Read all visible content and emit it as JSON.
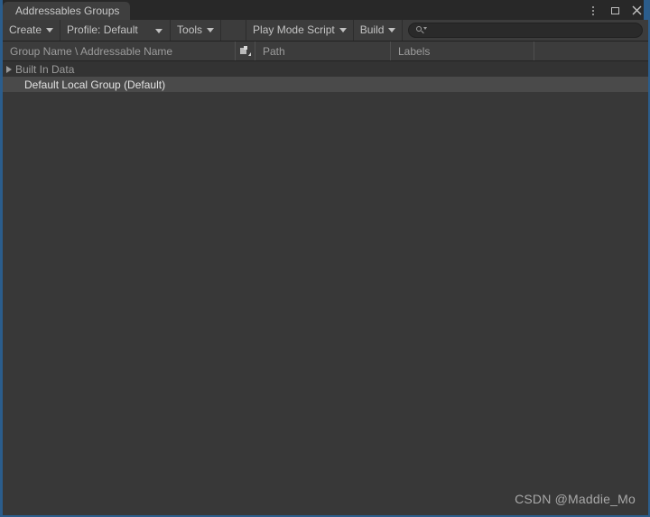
{
  "window": {
    "tab_title": "Addressables Groups",
    "accent_color": "#2b5d8c",
    "background_color": "#383838",
    "controls": [
      {
        "name": "kebab-menu",
        "label": "⋮"
      },
      {
        "name": "maximize",
        "label": "□"
      },
      {
        "name": "close",
        "label": "✕"
      }
    ]
  },
  "toolbar": {
    "create_label": "Create",
    "profile_label": "Profile: Default",
    "tools_label": "Tools",
    "spacer_label": "",
    "play_mode_script_label": "Play Mode Script",
    "build_label": "Build",
    "search": {
      "value": "",
      "placeholder": ""
    }
  },
  "columns": [
    {
      "label": "Group Name \\ Addressable Name"
    },
    {
      "label": ""
    },
    {
      "label": "Path"
    },
    {
      "label": "Labels"
    },
    {
      "label": ""
    }
  ],
  "tree": {
    "rows": [
      {
        "label": "Built In Data",
        "expandable": true,
        "expanded": false,
        "selected": false,
        "dim": true
      },
      {
        "label": "Default Local Group (Default)",
        "expandable": false,
        "expanded": false,
        "selected": true,
        "dim": false
      }
    ]
  },
  "watermark": {
    "text": "CSDN @Maddie_Mo"
  }
}
